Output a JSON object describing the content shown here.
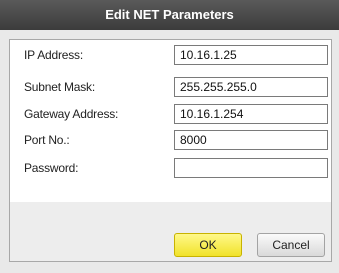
{
  "dialog": {
    "title": "Edit NET Parameters"
  },
  "fields": {
    "ip_address": {
      "label": "IP Address:",
      "value": "10.16.1.25"
    },
    "subnet_mask": {
      "label": "Subnet Mask:",
      "value": "255.255.255.0"
    },
    "gateway_address": {
      "label": "Gateway Address:",
      "value": "10.16.1.254"
    },
    "port": {
      "label": "Port No.:",
      "value": "8000"
    },
    "password": {
      "label": "Password:",
      "value": ""
    }
  },
  "buttons": {
    "ok_label": "OK",
    "cancel_label": "Cancel"
  },
  "colors": {
    "title_bar": "#4a4a4a",
    "ok_button": "#f5e634",
    "background": "#e9e9e9"
  }
}
